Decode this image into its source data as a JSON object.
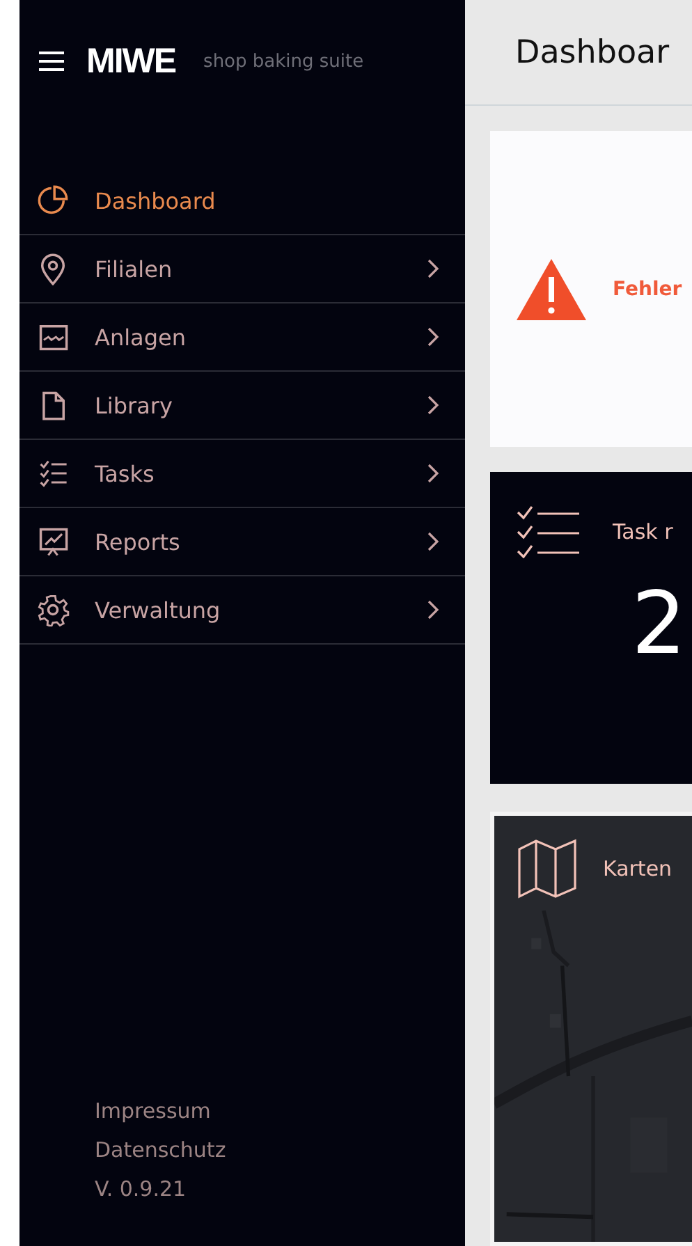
{
  "sidebar": {
    "brand": "MIWE",
    "tagline": "shop baking suite",
    "nav": [
      {
        "label": "Dashboard",
        "selected": true,
        "has_submenu": false
      },
      {
        "label": "Filialen",
        "selected": false,
        "has_submenu": true
      },
      {
        "label": "Anlagen",
        "selected": false,
        "has_submenu": true
      },
      {
        "label": "Library",
        "selected": false,
        "has_submenu": true
      },
      {
        "label": "Tasks",
        "selected": false,
        "has_submenu": true
      },
      {
        "label": "Reports",
        "selected": false,
        "has_submenu": true
      },
      {
        "label": "Verwaltung",
        "selected": false,
        "has_submenu": true
      }
    ],
    "footer_links": [
      "Impressum",
      "Datenschutz"
    ],
    "version": "V. 0.9.21"
  },
  "page_title": "Dashboar",
  "error_card": {
    "message": "Fehler"
  },
  "task_card": {
    "title": "Task r",
    "count": "2"
  },
  "map_card": {
    "title": "Karten"
  }
}
